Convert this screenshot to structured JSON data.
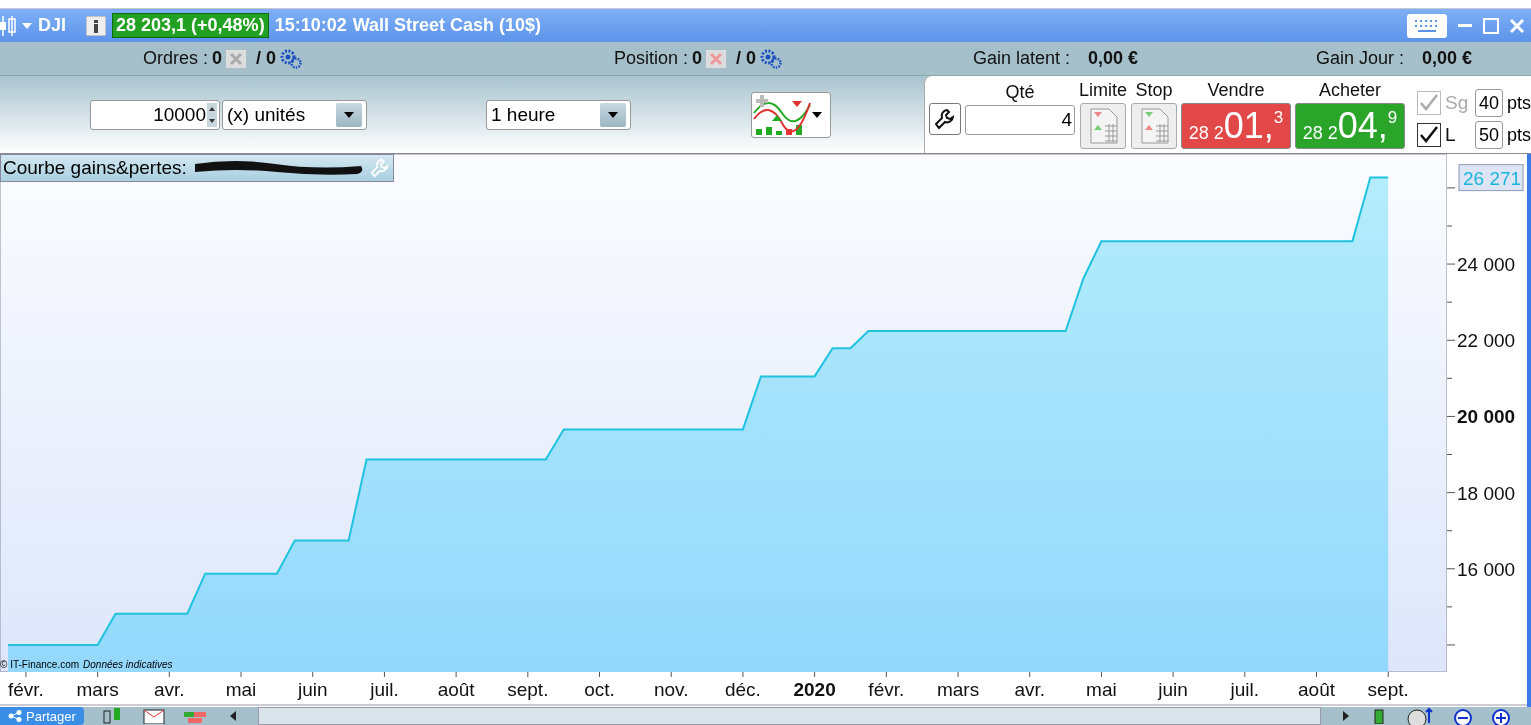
{
  "title_bar": {
    "symbol": "DJI",
    "price": "28 203,1 (+0,48%)",
    "time": "15:10:02",
    "instrument": "Wall Street Cash (10$)"
  },
  "status": {
    "orders": {
      "label": "Ordres :",
      "count": "0",
      "pending": "/ 0"
    },
    "position": {
      "label": "Position :",
      "count": "0",
      "pending": "/ 0"
    },
    "unrealized": {
      "label": "Gain latent :",
      "value": "0,00 €"
    },
    "daily": {
      "label": "Gain Jour :",
      "value": "0,00 €"
    }
  },
  "toolbar": {
    "amount": "10000",
    "unit": "(x) unités",
    "timeframe": "1 heure"
  },
  "order_panel": {
    "qty_label": "Qté",
    "qty": "4",
    "limit_label": "Limite",
    "stop_label": "Stop",
    "sell": {
      "label": "Vendre",
      "prefix": "28 2",
      "main": "01,",
      "sup": "3"
    },
    "buy": {
      "label": "Acheter",
      "prefix": "28 2",
      "main": "04,",
      "sup": "9"
    },
    "options": [
      {
        "label": "Sg",
        "checked": true,
        "disabled": true,
        "points": "40",
        "unit": "pts"
      },
      {
        "label": "L",
        "checked": true,
        "disabled": false,
        "points": "50",
        "unit": "pts"
      }
    ]
  },
  "chart": {
    "credit": "© IT-Finance.com",
    "note": "Données indicatives",
    "last_value": "26 271",
    "chart_data": {
      "type": "area",
      "categories": [
        null,
        "févr.",
        null,
        null,
        null,
        "mars",
        null,
        null,
        null,
        "avr.",
        null,
        null,
        null,
        "mai",
        null,
        null,
        null,
        "juin",
        null,
        null,
        null,
        "juil.",
        null,
        null,
        null,
        "août",
        null,
        null,
        null,
        "sept.",
        null,
        null,
        null,
        "oct.",
        null,
        null,
        null,
        "nov.",
        null,
        null,
        null,
        "déc.",
        null,
        null,
        null,
        "2020",
        null,
        null,
        null,
        "févr.",
        null,
        null,
        null,
        "mars",
        null,
        null,
        null,
        "avr.",
        null,
        null,
        null,
        "mai",
        null,
        null,
        null,
        "juin",
        null,
        null,
        null,
        "juil.",
        null,
        null,
        null,
        "août",
        null,
        null,
        null,
        "sept."
      ],
      "series": [
        {
          "name": "Courbe gains&pertes:",
          "color": "#1fc3e0",
          "values": [
            14000,
            14000,
            14000,
            14000,
            14000,
            14000,
            14820,
            14820,
            14820,
            14820,
            14820,
            15870,
            15870,
            15870,
            15870,
            15870,
            16740,
            16740,
            16740,
            16740,
            18870,
            18870,
            18870,
            18870,
            18870,
            18870,
            18870,
            18870,
            18870,
            18870,
            18870,
            19660,
            19660,
            19660,
            19660,
            19660,
            19660,
            19660,
            19660,
            19660,
            19660,
            19660,
            21050,
            21050,
            21050,
            21050,
            21790,
            21790,
            22240,
            22240,
            22240,
            22240,
            22240,
            22240,
            22240,
            22240,
            22240,
            22240,
            22240,
            22240,
            23630,
            24600,
            24600,
            24600,
            24600,
            24600,
            24600,
            24600,
            24600,
            24600,
            24600,
            24600,
            24600,
            24600,
            24600,
            24600,
            26270,
            26270
          ]
        }
      ],
      "ylim": [
        13290,
        26890
      ],
      "yticks": [
        {
          "value": 16000,
          "label": "16 000"
        },
        {
          "value": 18000,
          "label": "18 000"
        },
        {
          "value": 20000,
          "label": "20 000"
        },
        {
          "value": 22000,
          "label": "22 000"
        },
        {
          "value": 24000,
          "label": "24 000"
        }
      ]
    }
  },
  "bottom_bar": {
    "share": "Partager"
  }
}
